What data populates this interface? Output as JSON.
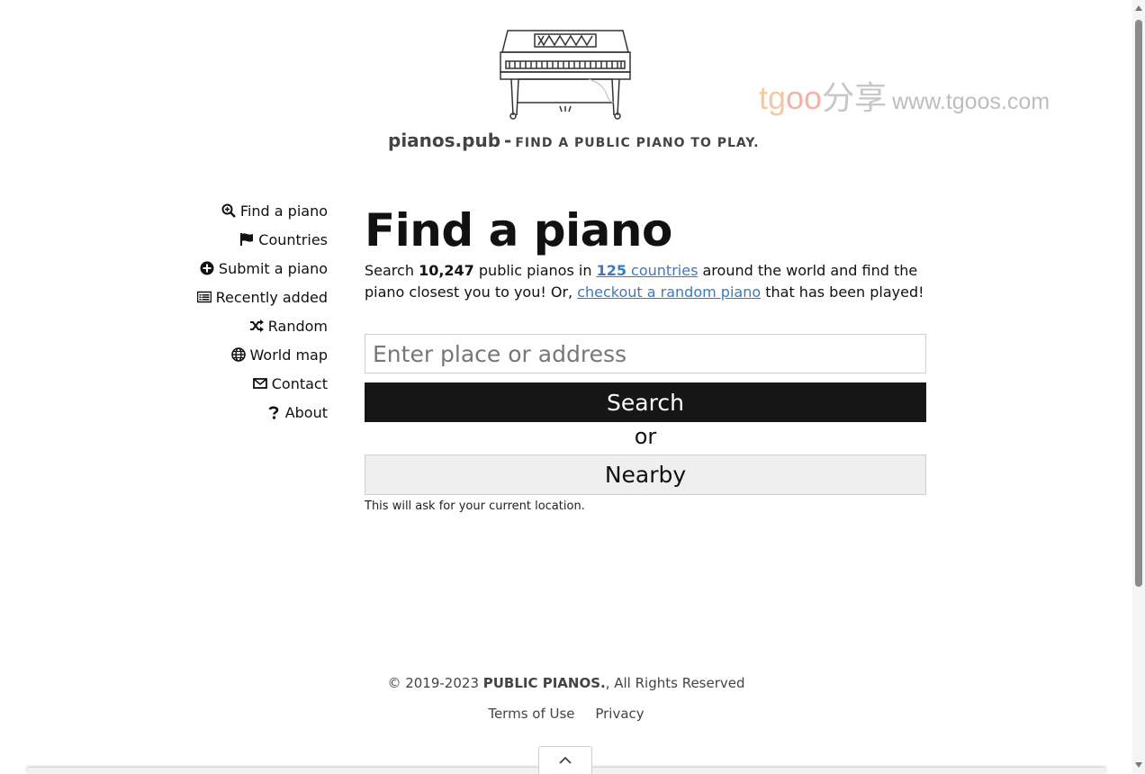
{
  "header": {
    "site_name": "pianos.pub",
    "separator": "-",
    "tagline": "FIND A PUBLIC PIANO TO PLAY.",
    "logo_icon": "piano-illustration"
  },
  "watermark": {
    "part1": "tg",
    "part2": "oo",
    "part3": "分享",
    "url": "www.tgoos.com"
  },
  "nav": {
    "items": [
      {
        "label": "Find a piano",
        "icon": "search-icon"
      },
      {
        "label": "Countries",
        "icon": "flag-icon"
      },
      {
        "label": "Submit a piano",
        "icon": "plus-circle-icon"
      },
      {
        "label": "Recently added",
        "icon": "list-icon"
      },
      {
        "label": "Random",
        "icon": "shuffle-icon"
      },
      {
        "label": "World map",
        "icon": "globe-icon"
      },
      {
        "label": "Contact",
        "icon": "envelope-icon"
      },
      {
        "label": "About",
        "icon": "question-icon"
      }
    ]
  },
  "main": {
    "title": "Find a piano",
    "intro": {
      "t1": "Search ",
      "count": "10,247",
      "t2": " public pianos in ",
      "countries_num": "125",
      "countries_word": " countries",
      "t3": " around the world and find the piano closest you to you! Or, ",
      "random_link": "checkout a random piano",
      "t4": " that has been played!"
    },
    "search_placeholder": "Enter place or address",
    "search_value": "",
    "search_button": "Search",
    "or_text": "or",
    "nearby_button": "Nearby",
    "hint": "This will ask for your current location."
  },
  "footer": {
    "copyright_prefix": "© 2019-2023 ",
    "company": "PUBLIC PIANOS.",
    "copyright_suffix": ", All Rights Reserved",
    "terms": "Terms of Use",
    "privacy": "Privacy"
  },
  "colors": {
    "link": "#3a7bbf",
    "search_button_bg": "#161616",
    "nearby_button_bg": "#efefef"
  }
}
